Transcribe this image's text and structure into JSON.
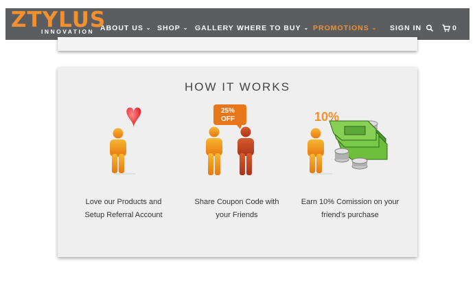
{
  "brand": {
    "name": "ZTYLUS",
    "tagline": "INNOVATION"
  },
  "nav": {
    "items": [
      {
        "label": "ABOUT US",
        "has_dropdown": true
      },
      {
        "label": "SHOP",
        "has_dropdown": true
      },
      {
        "label": "GALLERY",
        "has_dropdown": false
      },
      {
        "label": "WHERE TO BUY",
        "has_dropdown": true
      },
      {
        "label": "PROMOTIONS",
        "has_dropdown": true
      }
    ],
    "dropdown_glyph": "⌄",
    "sign_in": "SIGN IN",
    "cart_count": "0",
    "icons": {
      "search": "search-icon",
      "cart": "cart-icon"
    }
  },
  "how_it_works": {
    "title": "HOW IT WORKS",
    "steps": [
      {
        "line1": "Love our Products and",
        "line2": "Setup Referral Account"
      },
      {
        "line1": "Share Coupon Code with",
        "line2": "your Friends",
        "badge_line1": "25%",
        "badge_line2": "OFF"
      },
      {
        "line1": "Earn 10% Comission on your",
        "line2": "friend's purchase",
        "badge": "10%"
      }
    ]
  },
  "colors": {
    "brand_orange": "#f0902e",
    "nav_bg": "#5b5d60",
    "card_bg": "#efefef",
    "person_orange": "#f29a1c",
    "person_red": "#c44420",
    "money_green": "#5aa033"
  }
}
